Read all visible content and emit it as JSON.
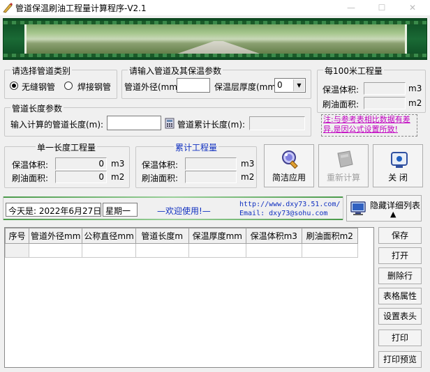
{
  "window": {
    "title": "管道保温刷油工程量计算程序-V2.1"
  },
  "pipe_type": {
    "title": "请选择管道类别",
    "options": [
      {
        "label": "无缝钢管",
        "checked": true
      },
      {
        "label": "焊接钢管",
        "checked": false
      }
    ]
  },
  "params": {
    "title": "请输入管道及其保温参数",
    "outer_diameter_label": "管道外径(mm)",
    "outer_diameter_value": "",
    "thickness_label": "保温层厚度(mm)",
    "thickness_value": "0"
  },
  "per100": {
    "title": "每100米工程量",
    "volume_label": "保温体积:",
    "volume_unit": "m3",
    "volume_value": "",
    "area_label": "刷油面积:",
    "area_unit": "m2",
    "area_value": ""
  },
  "length": {
    "title": "管道长度参数",
    "calc_label": "输入计算的管道长度(m):",
    "calc_value": "",
    "total_label": "管道累计长度(m):",
    "total_value": ""
  },
  "note": "注:与参考表相比数据有差异,是因公式设置所致!",
  "single": {
    "title": "单一长度工程量",
    "volume_label": "保温体积:",
    "volume_value": "0",
    "volume_unit": "m3",
    "area_label": "刷油面积:",
    "area_value": "0",
    "area_unit": "m2"
  },
  "cumulative": {
    "title": "累计工程量",
    "volume_label": "保温体积:",
    "volume_value": "",
    "volume_unit": "m3",
    "area_label": "刷油面积:",
    "area_value": "",
    "area_unit": "m2"
  },
  "actions": {
    "apply": "简洁应用",
    "recalc": "重新计算",
    "close": "关  闭"
  },
  "info": {
    "date": "今天是: 2022年6月27日",
    "weekday": "星期一",
    "welcome": "—欢迎使用!—",
    "url": "http://www.dxy73.51.com/",
    "email": "Email:   dxy73@sohu.com"
  },
  "hide_list": {
    "label": "隐藏详细列表",
    "arrow": "▲"
  },
  "table": {
    "columns": [
      "序号",
      "管道外径mm",
      "公称直径mm",
      "管道长度m",
      "保温厚度mm",
      "保温体积m3",
      "刷油面积m2"
    ]
  },
  "side_buttons": [
    "保存",
    "打开",
    "删除行",
    "表格属性",
    "设置表头",
    "打印",
    "打印预览"
  ],
  "colors": {
    "accent_blue": "#1030c0",
    "note_magenta": "#c000c0",
    "banner_green": "#1a6a35"
  }
}
